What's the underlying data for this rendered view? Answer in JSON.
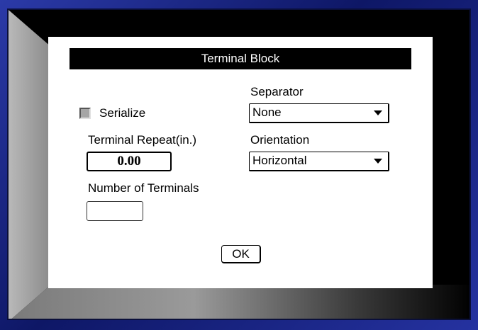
{
  "dialog": {
    "title": "Terminal Block",
    "serialize_label": "Serialize",
    "serialize_checked": false,
    "terminal_repeat_label": "Terminal Repeat(in.)",
    "terminal_repeat_value": "0.00",
    "number_of_terminals_label": "Number of Terminals",
    "number_of_terminals_value": "",
    "separator_label": "Separator",
    "separator_value": "None",
    "orientation_label": "Orientation",
    "orientation_value": "Horizontal",
    "ok_label": "OK"
  },
  "colors": {
    "frame": "#1c2a8c",
    "panel": "#ffffff",
    "title_bar": "#000000",
    "checkbox_fill": "#a6a6a6"
  }
}
